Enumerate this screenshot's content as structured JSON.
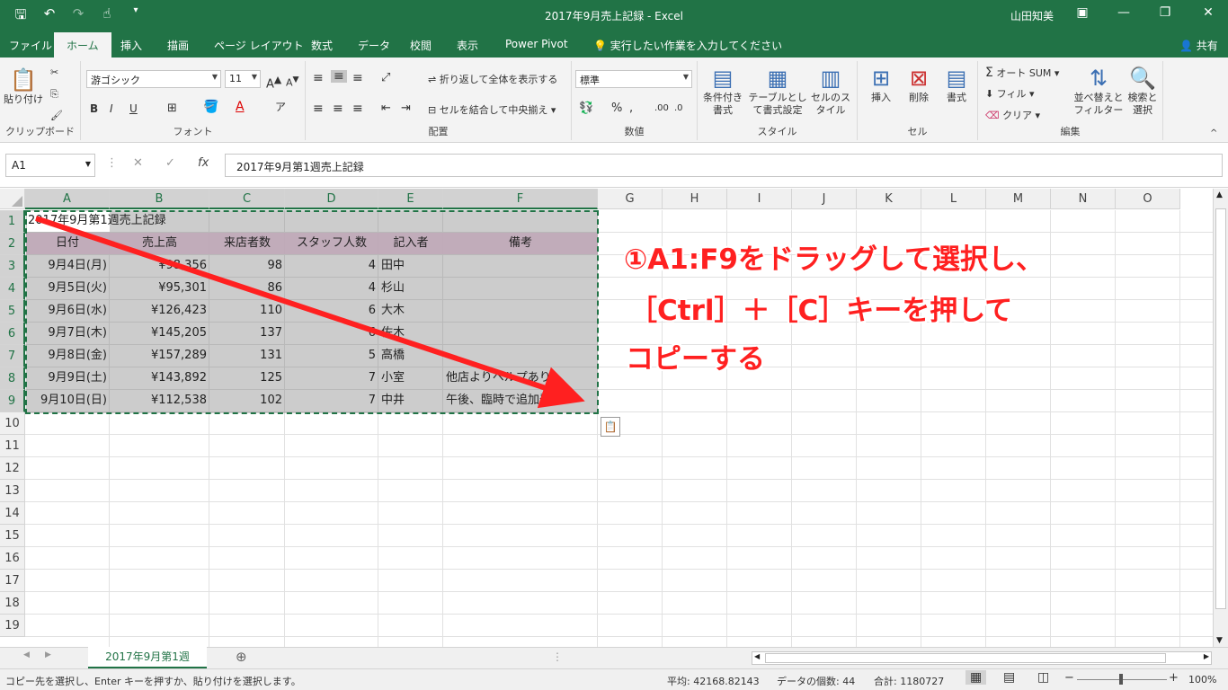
{
  "window": {
    "title": "2017年9月売上記録  -  Excel",
    "user": "山田知美"
  },
  "tabs": [
    {
      "label": "ファイル"
    },
    {
      "label": "ホーム"
    },
    {
      "label": "挿入"
    },
    {
      "label": "描画"
    },
    {
      "label": "ページ レイアウト"
    },
    {
      "label": "数式"
    },
    {
      "label": "データ"
    },
    {
      "label": "校閲"
    },
    {
      "label": "表示"
    },
    {
      "label": "Power Pivot"
    },
    {
      "label": "実行したい作業を入力してください"
    }
  ],
  "share_label": "共有",
  "ribbon": {
    "clipboard": {
      "paste": "貼り付け",
      "group": "クリップボード"
    },
    "font": {
      "name": "游ゴシック",
      "size": "11",
      "group": "フォント",
      "bold": "B",
      "italic": "I",
      "underline": "U"
    },
    "alignment": {
      "wrap": "折り返して全体を表示する",
      "merge": "セルを結合して中央揃え",
      "group": "配置"
    },
    "number": {
      "format": "標準",
      "group": "数値",
      "percent": "%"
    },
    "styles": {
      "conditional": "条件付き書式",
      "table": "テーブルとして書式設定",
      "cell": "セルのスタイル",
      "group": "スタイル"
    },
    "cells": {
      "insert": "挿入",
      "delete": "削除",
      "format": "書式",
      "group": "セル"
    },
    "editing": {
      "autosum": "オート SUM",
      "fill": "フィル",
      "clear": "クリア",
      "sort": "並べ替えとフィルター",
      "find": "検索と選択",
      "group": "編集"
    }
  },
  "formula_bar": {
    "name_box": "A1",
    "fx": "fx",
    "content": "2017年9月第1週売上記録"
  },
  "columns": [
    "A",
    "B",
    "C",
    "D",
    "E",
    "F",
    "G",
    "H",
    "I",
    "J",
    "K",
    "L",
    "M",
    "N",
    "O"
  ],
  "rows": [
    "1",
    "2",
    "3",
    "4",
    "5",
    "6",
    "7",
    "8",
    "9",
    "10",
    "11",
    "12",
    "13",
    "14",
    "15",
    "16",
    "17",
    "18",
    "19"
  ],
  "sheet": {
    "title_cell": "2017年9月第1週売上記録",
    "headers": [
      "日付",
      "売上高",
      "来店者数",
      "スタッフ人数",
      "記入者",
      "備考"
    ],
    "data": [
      [
        "9月4日(月)",
        "¥98,356",
        "98",
        "4",
        "田中",
        ""
      ],
      [
        "9月5日(火)",
        "¥95,301",
        "86",
        "4",
        "杉山",
        ""
      ],
      [
        "9月6日(水)",
        "¥126,423",
        "110",
        "6",
        "大木",
        ""
      ],
      [
        "9月7日(木)",
        "¥145,205",
        "137",
        "6",
        "佐木",
        ""
      ],
      [
        "9月8日(金)",
        "¥157,289",
        "131",
        "5",
        "高橋",
        ""
      ],
      [
        "9月9日(土)",
        "¥143,892",
        "125",
        "7",
        "小室",
        "他店よりヘルプあり"
      ],
      [
        "9月10日(日)",
        "¥112,538",
        "102",
        "7",
        "中井",
        "午後、臨時で追加発注"
      ]
    ]
  },
  "sheet_tab": "2017年9月第1週",
  "status": {
    "message": "コピー先を選択し、Enter キーを押すか、貼り付けを選択します。",
    "average": "平均: 42168.82143",
    "count": "データの個数: 44",
    "sum": "合計: 1180727",
    "zoom": "100%"
  },
  "annotation": {
    "line1": "①A1:F9をドラッグして選択し、",
    "line2": "［Ctrl］＋［C］キーを押して",
    "line3": "コピーする"
  },
  "colors": {
    "accent": "#217346",
    "header_fill": "#c0a8b8",
    "annotation": "#ff2020"
  }
}
